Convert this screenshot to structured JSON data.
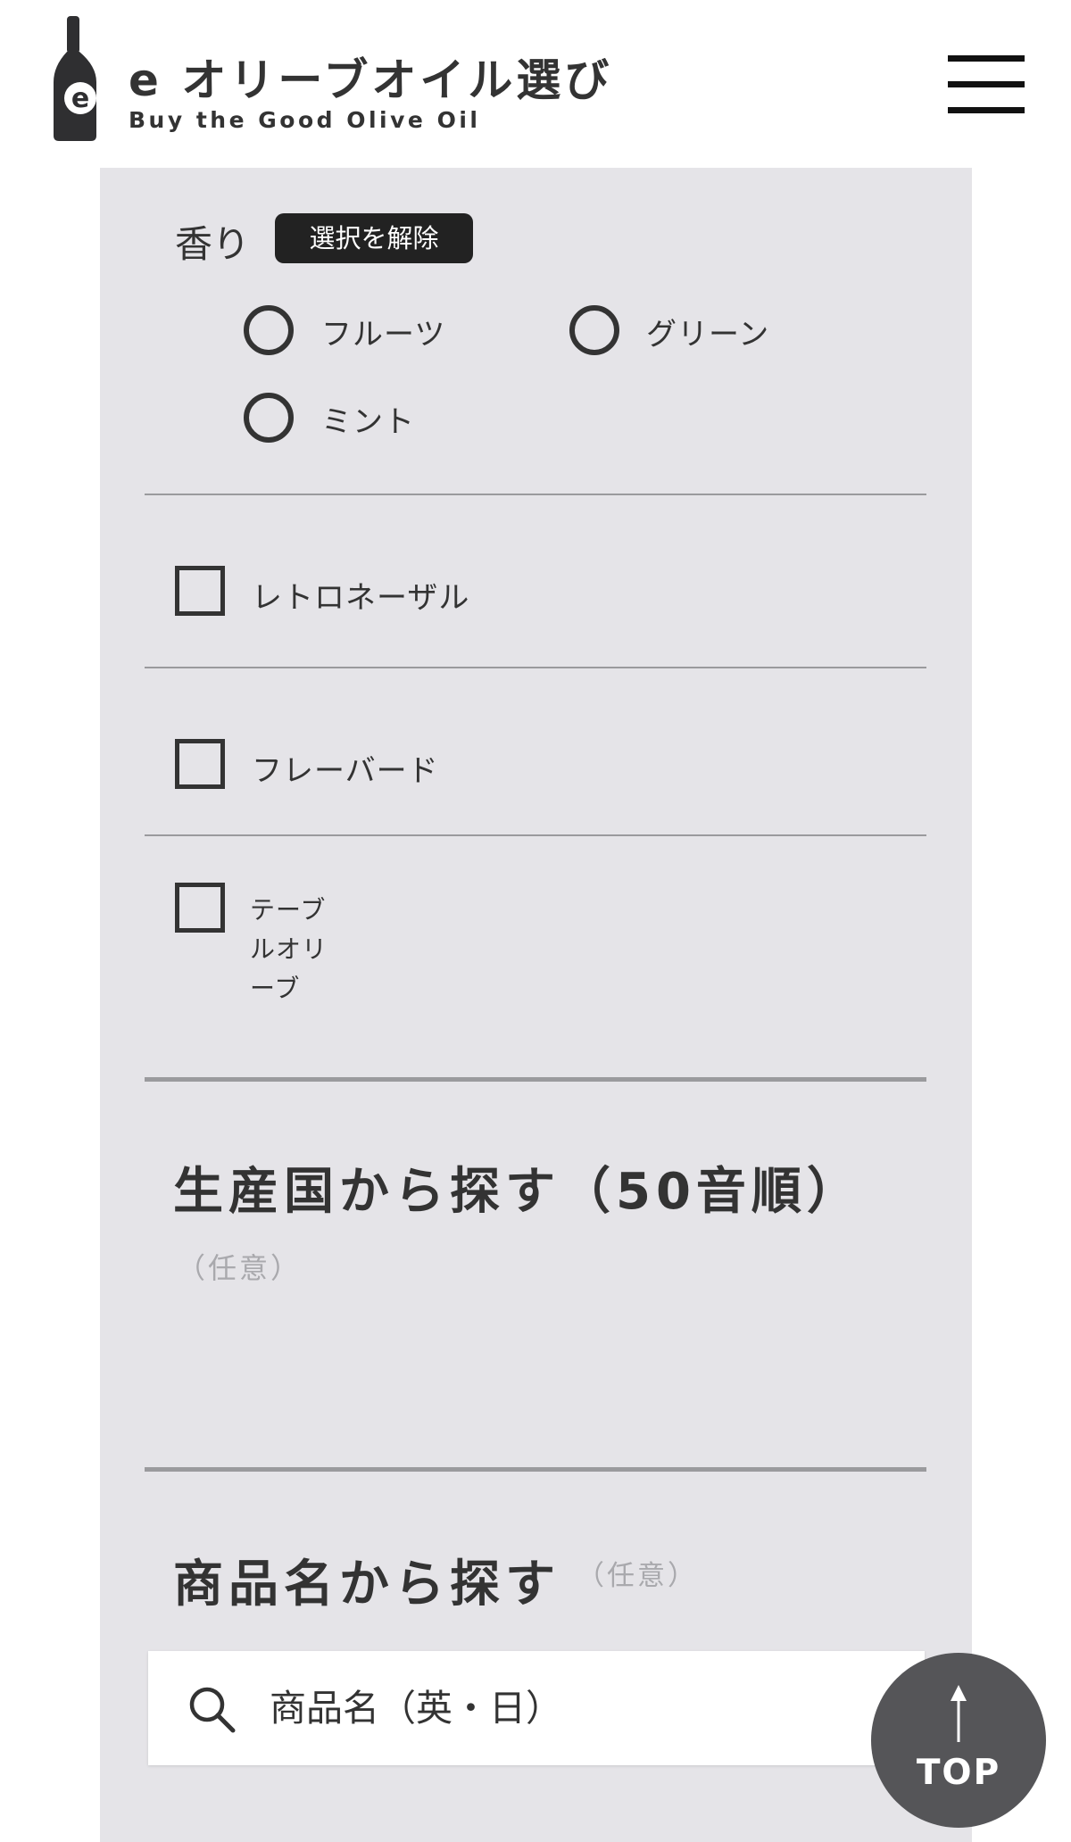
{
  "header": {
    "title": "e オリーブオイル選び",
    "subtitle": "Buy the Good Olive Oil",
    "menu_icon": "hamburger-menu-icon"
  },
  "aroma": {
    "label": "香り",
    "clear_button": "選択を解除",
    "options": [
      {
        "label": "フルーツ",
        "selected": false
      },
      {
        "label": "グリーン",
        "selected": false
      },
      {
        "label": "ミント",
        "selected": false
      }
    ]
  },
  "categories": [
    {
      "label": "レトロネーザル",
      "checked": false
    },
    {
      "label": "フレーバード",
      "checked": false
    },
    {
      "label": "テーブ\nルオリ\nーブ",
      "checked": false
    }
  ],
  "country_section": {
    "heading": "生産国から探す（50音順）",
    "optional": "（任意）"
  },
  "product_section": {
    "heading": "商品名から探す",
    "optional": "（任意）",
    "search_placeholder": "商品名（英・日）",
    "search_icon": "search-icon"
  },
  "top_button": {
    "label": "TOP",
    "icon": "arrow-up-icon"
  }
}
